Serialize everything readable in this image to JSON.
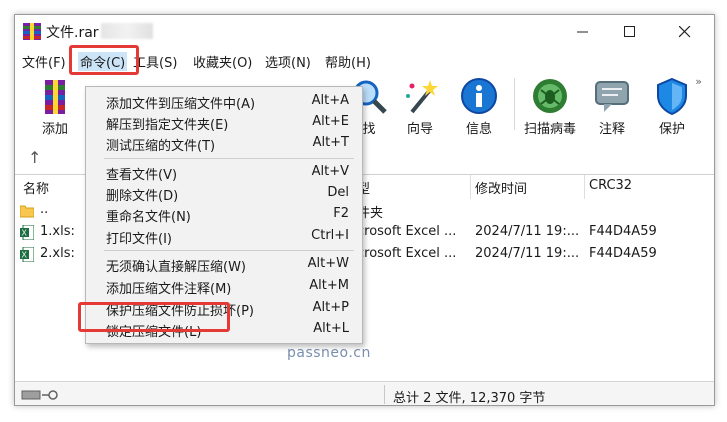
{
  "window": {
    "title": "文件.rar"
  },
  "menubar": {
    "items": [
      "文件(F)",
      "命令(C)",
      "工具(S)",
      "收藏夹(O)",
      "选项(N)",
      "帮助(H)"
    ]
  },
  "toolbar": {
    "buttons": [
      {
        "label": "添加",
        "icon": "add-archive-icon"
      },
      {
        "label": "查找",
        "icon": "find-icon"
      },
      {
        "label": "向导",
        "icon": "wizard-icon"
      },
      {
        "label": "信息",
        "icon": "info-icon"
      },
      {
        "label": "扫描病毒",
        "icon": "virus-scan-icon"
      },
      {
        "label": "注释",
        "icon": "comment-icon"
      },
      {
        "label": "保护",
        "icon": "protect-icon"
      }
    ],
    "find_visible_label": "找"
  },
  "list": {
    "columns": [
      "名称",
      "类型",
      "修改时间",
      "CRC32"
    ],
    "columns_visible": {
      "type": "型"
    },
    "rows": [
      {
        "name": "..",
        "type": "文件夹",
        "type_visible": "件夹",
        "modified": "",
        "crc": ""
      },
      {
        "name": "1.xlsx",
        "name_visible": "1.xls:",
        "type": "Microsoft Excel ...",
        "type_visible": "crosoft Excel ...",
        "modified": "2024/7/11 19:...",
        "crc": "F44D4A59"
      },
      {
        "name": "2.xlsx",
        "name_visible": "2.xls:",
        "type": "Microsoft Excel ...",
        "type_visible": "crosoft Excel ...",
        "modified": "2024/7/11 19:...",
        "crc": "F44D4A59"
      }
    ]
  },
  "dropdown": {
    "items": [
      {
        "label": "添加文件到压缩文件中(A)",
        "key": "Alt+A"
      },
      {
        "label": "解压到指定文件夹(E)",
        "key": "Alt+E"
      },
      {
        "label": "测试压缩的文件(T)",
        "key": "Alt+T"
      },
      {
        "label": "查看文件(V)",
        "key": "Alt+V"
      },
      {
        "label": "删除文件(D)",
        "key": "Del"
      },
      {
        "label": "重命名文件(N)",
        "key": "F2"
      },
      {
        "label": "打印文件(I)",
        "key": "Ctrl+I"
      },
      {
        "label": "无须确认直接解压缩(W)",
        "key": "Alt+W"
      },
      {
        "label": "添加压缩文件注释(M)",
        "key": "Alt+M"
      },
      {
        "label": "保护压缩文件防止损坏(P)",
        "key": "Alt+P"
      },
      {
        "label": "锁定压缩文件(L)",
        "key": "Alt+L"
      }
    ]
  },
  "statusbar": {
    "text": "总计 2 文件, 12,370 字节"
  },
  "watermark": "passneo.cn",
  "colors": {
    "highlight": "#e53935",
    "accent": "#1565c0"
  }
}
